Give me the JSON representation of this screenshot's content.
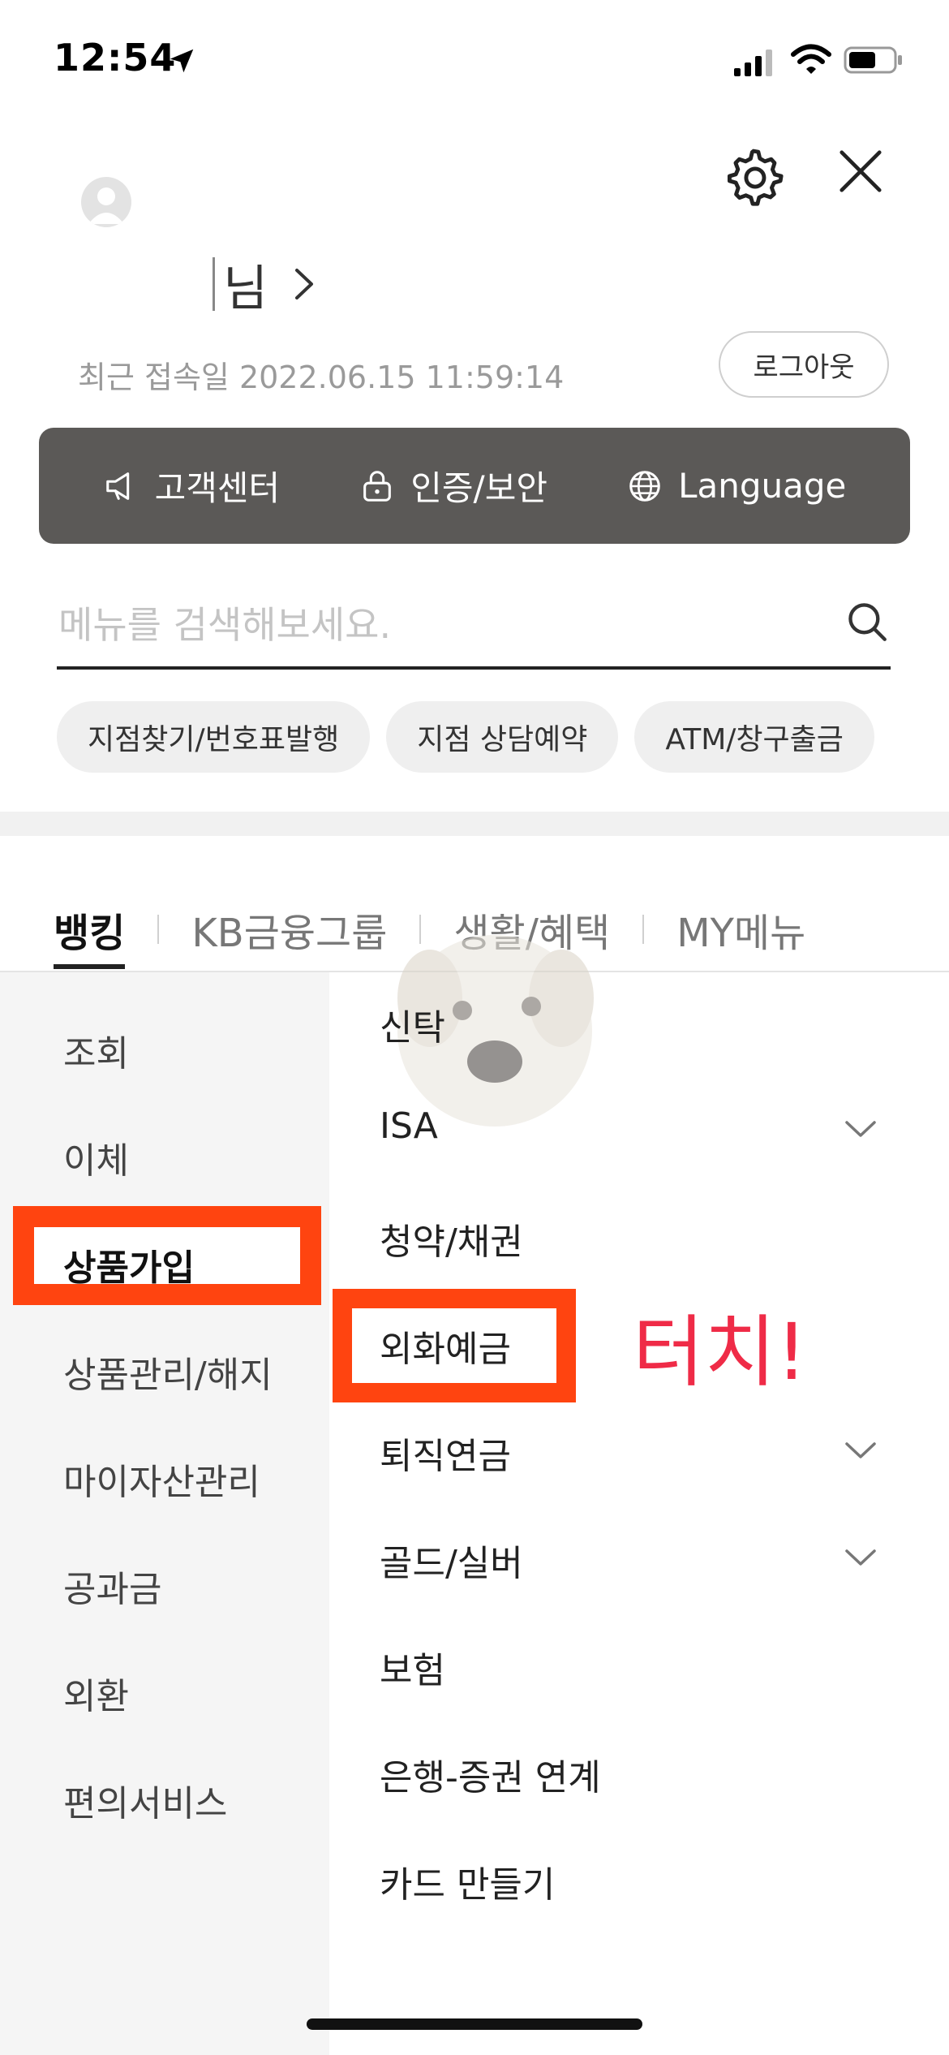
{
  "status_bar": {
    "time": "12:54"
  },
  "header": {
    "user_suffix": "님",
    "last_login_label": "최근 접속일 2022.06.15 11:59:14",
    "logout_label": "로그아웃"
  },
  "quick_bar": [
    {
      "icon": "megaphone-icon",
      "label": "고객센터"
    },
    {
      "icon": "lock-icon",
      "label": "인증/보안"
    },
    {
      "icon": "globe-icon",
      "label": "Language"
    }
  ],
  "search": {
    "placeholder": "메뉴를 검색해보세요."
  },
  "chips": [
    "지점찾기/번호표발행",
    "지점 상담예약",
    "ATM/창구출금"
  ],
  "tabs": [
    "뱅킹",
    "KB금융그룹",
    "생활/혜택",
    "MY메뉴"
  ],
  "categories": [
    "조회",
    "이체",
    "상품가입",
    "상품관리/해지",
    "마이자산관리",
    "공과금",
    "외환",
    "편의서비스"
  ],
  "active_category": "상품가입",
  "submenu": [
    "신탁",
    "ISA",
    "청약/채권",
    "외화예금",
    "퇴직연금",
    "골드/실버",
    "보험",
    "은행-증권 연계",
    "카드 만들기"
  ],
  "submenu_expandable": [
    "ISA",
    "퇴직연금",
    "골드/실버"
  ],
  "annotation": {
    "text": "터치!"
  },
  "colors": {
    "highlight": "#ff4410",
    "annotation": "#ef2b47",
    "quick_bar_bg": "#5b5957"
  }
}
